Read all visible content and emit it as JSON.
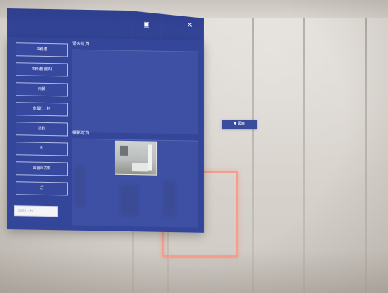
{
  "panel": {
    "titlebar": {
      "icon_button": {
        "icon": "display-icon",
        "label": ""
      },
      "close_button": {
        "icon": "close-icon",
        "label": ""
      }
    },
    "nav_buttons": [
      {
        "label": "事務連"
      },
      {
        "label": "事務連(書式)"
      },
      {
        "label": "内装"
      },
      {
        "label": "金属仕上材"
      },
      {
        "label": "塗料"
      },
      {
        "label": "B"
      },
      {
        "label": "図面の共有"
      },
      {
        "label": "ご"
      }
    ],
    "input": {
      "placeholder": "記録を入力..."
    },
    "sections": {
      "past_photos": {
        "title": "過去写真"
      },
      "taken_photos": {
        "title": "撮影写真"
      }
    }
  },
  "wall_tag": {
    "label": "▼ 図面"
  },
  "colors": {
    "panel": "#34469a",
    "titlebar": "#2f3f8f",
    "target_outline": "#f2a08c"
  }
}
